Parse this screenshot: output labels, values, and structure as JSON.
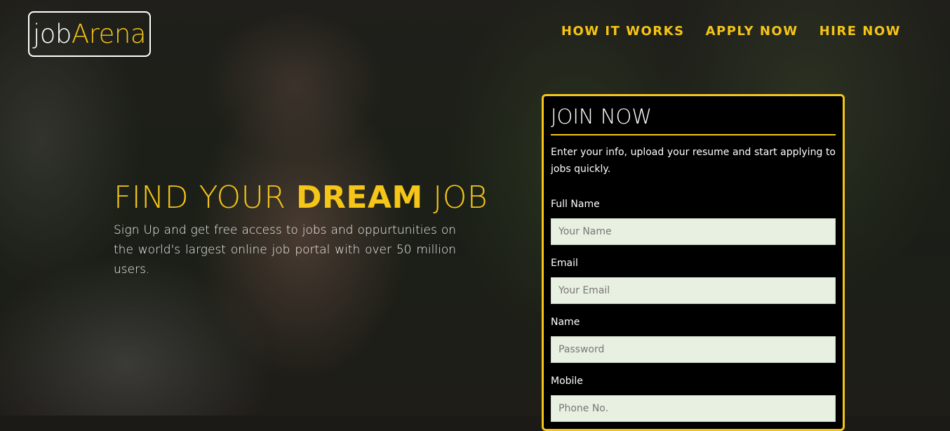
{
  "brand": {
    "logo_part1": "job",
    "logo_part2": "Arena"
  },
  "nav": {
    "how_it_works": "HOW IT WORKS",
    "apply_now": "APPLY NOW",
    "hire_now": "HIRE NOW"
  },
  "hero": {
    "headline_part1": "FIND YOUR ",
    "headline_bold": "DREAM",
    "headline_part2": " JOB",
    "subtext": "Sign Up and get free access to jobs and oppurtunities on the world's largest online job portal with over 50 million users."
  },
  "join_form": {
    "title": "JOIN NOW",
    "description": "Enter your info, upload your resume and start applying to jobs quickly.",
    "fields": [
      {
        "label": "Full Name",
        "placeholder": "Your Name"
      },
      {
        "label": "Email",
        "placeholder": "Your Email"
      },
      {
        "label": "Name",
        "placeholder": "Password"
      },
      {
        "label": "Mobile",
        "placeholder": "Phone No."
      }
    ]
  },
  "colors": {
    "accent": "#f5c518",
    "panel_bg": "#000000",
    "input_bg": "#e8f0e1"
  }
}
